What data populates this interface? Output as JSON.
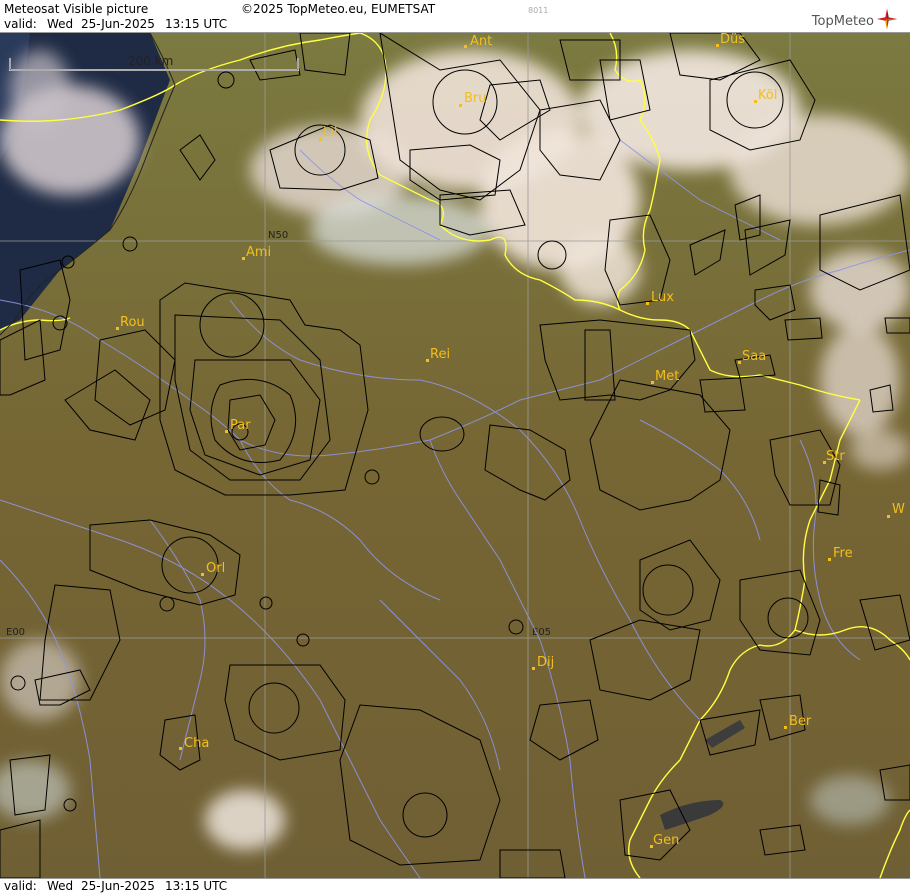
{
  "header": {
    "title": "Meteosat Visible picture",
    "copyright": "©2025 TopMeteo.eu, EUMETSAT",
    "code": "8011",
    "valid_label": "valid:",
    "valid_day": "Wed",
    "valid_date": "25-Jun-2025",
    "valid_time": "13:15 UTC",
    "logo_text": "TopMeteo"
  },
  "footer": {
    "valid_label": "valid:",
    "valid_day": "Wed",
    "valid_date": "25-Jun-2025",
    "valid_time": "13:15 UTC"
  },
  "map": {
    "scale_label": "200 km",
    "grid_labels": {
      "lat": "N50",
      "lon0": "E00",
      "lon5": "E05"
    },
    "cities": [
      {
        "id": "ant",
        "label": "Ant"
      },
      {
        "id": "dus",
        "label": "Düs"
      },
      {
        "id": "bru",
        "label": "Bru"
      },
      {
        "id": "kol",
        "label": "Köl"
      },
      {
        "id": "lil",
        "label": "Lil"
      },
      {
        "id": "ami",
        "label": "Ami"
      },
      {
        "id": "lux",
        "label": "Lux"
      },
      {
        "id": "rou",
        "label": "Rou"
      },
      {
        "id": "rei",
        "label": "Rei"
      },
      {
        "id": "saa",
        "label": "Saa"
      },
      {
        "id": "met",
        "label": "Met"
      },
      {
        "id": "par",
        "label": "Par"
      },
      {
        "id": "str",
        "label": "Str"
      },
      {
        "id": "w",
        "label": "W"
      },
      {
        "id": "fre",
        "label": "Fre"
      },
      {
        "id": "orl",
        "label": "Orl"
      },
      {
        "id": "dij",
        "label": "Dij"
      },
      {
        "id": "ber",
        "label": "Ber"
      },
      {
        "id": "cha",
        "label": "Cha"
      },
      {
        "id": "gen",
        "label": "Gen"
      }
    ],
    "colors": {
      "land": "#7a6a36",
      "sea": "#1e2a44",
      "cloud": "#efe4da",
      "border": "#ffff40",
      "river": "#8e95e6",
      "airspace": "#000000",
      "city": "#f3bf1c"
    }
  }
}
